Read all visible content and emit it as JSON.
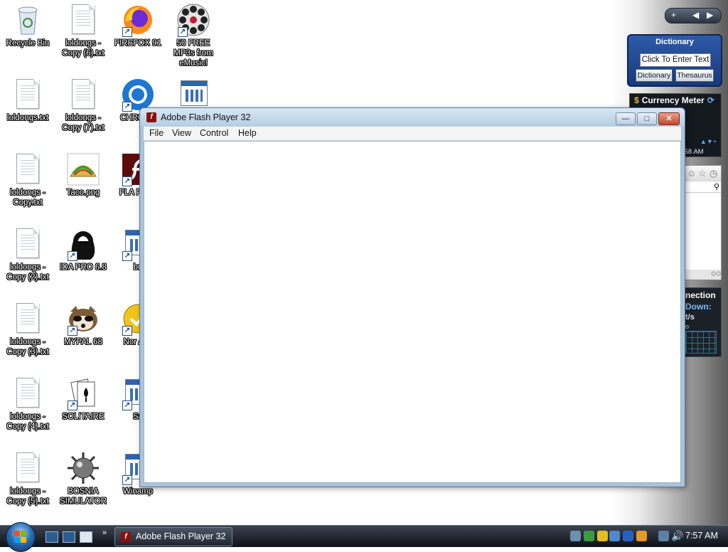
{
  "desktop": {
    "icons": [
      {
        "label": "Recycle Bin",
        "icon": "recycle-bin-icon"
      },
      {
        "label": "loldongs - Copy (6).txt",
        "icon": "text-file-icon"
      },
      {
        "label": "FIREFOX 91",
        "icon": "firefox-icon"
      },
      {
        "label": "50 FREE MP3s from eMusic!",
        "icon": "film-reel-icon"
      },
      {
        "label": "loldongs.txt",
        "icon": "text-file-icon"
      },
      {
        "label": "loldongs - Copy (7).txt",
        "icon": "text-file-icon"
      },
      {
        "label": "CHRO 10",
        "icon": "chrome-icon"
      },
      {
        "label": "loldongs - Copy.txt",
        "icon": "text-file-icon"
      },
      {
        "label": "Taco.png",
        "icon": "taco-image-icon"
      },
      {
        "label": "FLA PLAY",
        "icon": "flash-player-icon"
      },
      {
        "label": "loldongs - Copy (2).txt",
        "icon": "text-file-icon"
      },
      {
        "label": "IDA PRO 6.8",
        "icon": "ida-pro-icon"
      },
      {
        "label": "bu",
        "icon": "window-app-icon"
      },
      {
        "label": "loldongs - Copy (3).txt",
        "icon": "text-file-icon"
      },
      {
        "label": "MYPAL 68",
        "icon": "raccoon-icon"
      },
      {
        "label": "Nor Anti",
        "icon": "norton-antivirus-icon"
      },
      {
        "label": "loldongs - Copy (4).txt",
        "icon": "text-file-icon"
      },
      {
        "label": "SOLITAIRE",
        "icon": "solitaire-cards-icon"
      },
      {
        "label": "Sa",
        "icon": "window-app-icon"
      },
      {
        "label": "loldongs - Copy (5).txt",
        "icon": "text-file-icon"
      },
      {
        "label": "BOSNIA SIMULATOR",
        "icon": "mine-icon"
      },
      {
        "label": "Winamp",
        "icon": "window-app-icon"
      }
    ]
  },
  "flash_window": {
    "title": "Adobe Flash Player 32",
    "menu": [
      "File",
      "View",
      "Control",
      "Help"
    ],
    "minimize": "—",
    "maximize": "□",
    "close": "✕"
  },
  "gadgets": {
    "top_controls": [
      "+",
      "◀",
      "▶"
    ],
    "dictionary": {
      "header": "Dictionary",
      "input_placeholder": "Click To Enter Text",
      "btn_dictionary": "Dictionary",
      "btn_thesaurus": "Thesaurus"
    },
    "currency": {
      "header": "Currency Meter",
      "time_partial": ":58 AM",
      "arrows": "▲▼+"
    },
    "network": {
      "line1": "nection",
      "line2": "Down:",
      "line3": "t/s",
      "line4": "o"
    },
    "search_footer": "◇◇"
  },
  "taskbar": {
    "active_task": "Adobe Flash Player 32",
    "quicklaunch_more": "»",
    "clock": "7:57 AM"
  },
  "colors": {
    "taskbar": "#1a1f27",
    "window_frame": "#a9c3d9",
    "flash_red": "#8a1111"
  }
}
